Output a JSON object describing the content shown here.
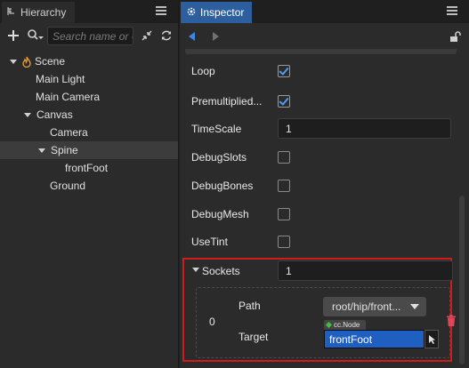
{
  "hierarchy": {
    "tab_label": "Hierarchy",
    "search_placeholder": "Search name or UUID",
    "tree": [
      {
        "label": "Scene",
        "level": 0,
        "expanded": true,
        "icon": "scene-flame-icon"
      },
      {
        "label": "Main Light",
        "level": 1
      },
      {
        "label": "Main Camera",
        "level": 1
      },
      {
        "label": "Canvas",
        "level": 1,
        "expanded": true
      },
      {
        "label": "Camera",
        "level": 2
      },
      {
        "label": "Spine",
        "level": 2,
        "expanded": true,
        "selected": true
      },
      {
        "label": "frontFoot",
        "level": 3
      },
      {
        "label": "Ground",
        "level": 2
      }
    ]
  },
  "inspector": {
    "tab_label": "Inspector",
    "properties": {
      "loop": {
        "label": "Loop",
        "checked": true
      },
      "premultiplied": {
        "label": "Premultiplied...",
        "checked": true
      },
      "timescale": {
        "label": "TimeScale",
        "value": "1"
      },
      "debug_slots": {
        "label": "DebugSlots",
        "checked": false
      },
      "debug_bones": {
        "label": "DebugBones",
        "checked": false
      },
      "debug_mesh": {
        "label": "DebugMesh",
        "checked": false
      },
      "use_tint": {
        "label": "UseTint",
        "checked": false
      }
    },
    "sockets": {
      "label": "Sockets",
      "count": "1",
      "items": [
        {
          "index": "0",
          "path_label": "Path",
          "path_value": "root/hip/front...",
          "target_label": "Target",
          "target_type": "cc.Node",
          "target_value": "frontFoot"
        }
      ]
    }
  },
  "colors": {
    "accent_blue": "#2d5f9e",
    "checkbox_blue": "#4d9cf5",
    "highlight_red": "#d11a1a",
    "delete_red": "#e0455a"
  }
}
